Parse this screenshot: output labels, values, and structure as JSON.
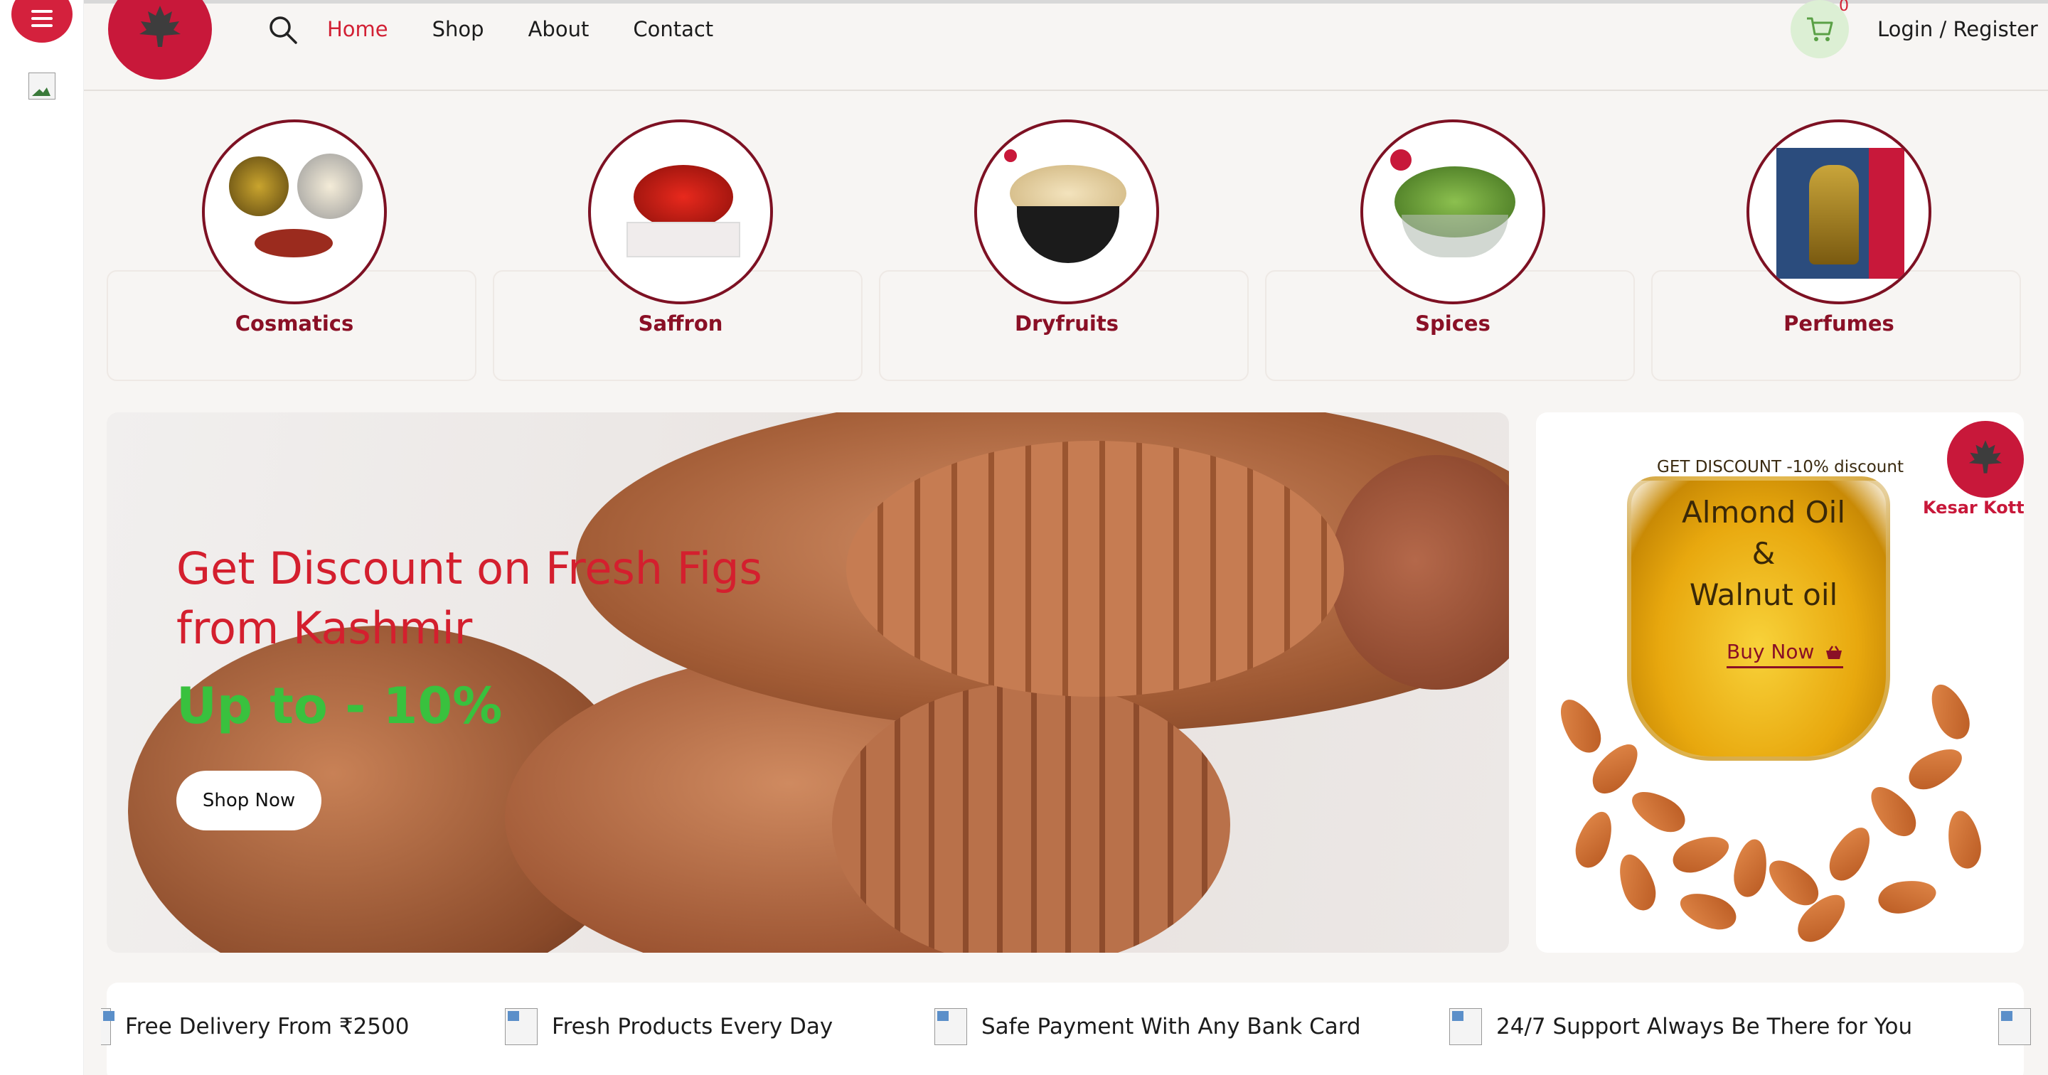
{
  "header": {
    "nav": [
      {
        "label": "Home",
        "active": true
      },
      {
        "label": "Shop"
      },
      {
        "label": "About"
      },
      {
        "label": "Contact"
      }
    ],
    "cart_count": "0",
    "login_label": "Login / Register"
  },
  "categories": [
    {
      "label": "Cosmatics"
    },
    {
      "label": "Saffron"
    },
    {
      "label": "Dryfruits"
    },
    {
      "label": "Spices"
    },
    {
      "label": "Perfumes"
    }
  ],
  "hero": {
    "title": "Get Discount on Fresh Figs from Kashmir",
    "subtitle": "Up to - 10%",
    "button": "Shop Now"
  },
  "promo": {
    "kicker": "GET DISCOUNT -10% discount",
    "title_line1": "Almond Oil",
    "title_line2": "&",
    "title_line3": "Walnut oil",
    "buy_label": "Buy Now",
    "brand": "Kesar Kotta"
  },
  "features": [
    {
      "label": "Free Delivery From ₹2500"
    },
    {
      "label": "Fresh Products Every Day"
    },
    {
      "label": "Safe Payment With Any Bank Card"
    },
    {
      "label": "24/7 Support Always Be There for You"
    }
  ],
  "colors": {
    "brand": "#c8183a",
    "accent_text": "#8a1026",
    "nav_active": "#d22034",
    "discount_green": "#39c13e",
    "background": "#f7f5f3"
  },
  "icons": [
    "menu-icon",
    "search-icon",
    "cart-icon",
    "basket-icon",
    "maple-leaf-logo"
  ]
}
